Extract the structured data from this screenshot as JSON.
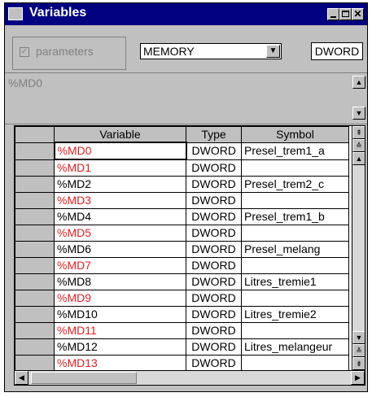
{
  "window": {
    "title": "Variables"
  },
  "toolbar": {
    "parameters_label": "parameters",
    "parameters_checked": true,
    "memory_select": "MEMORY",
    "type_button": "DWORD"
  },
  "comment": {
    "text": "%MD0"
  },
  "grid": {
    "headers": {
      "variable": "Variable",
      "type": "Type",
      "symbol": "Symbol"
    },
    "rows": [
      {
        "variable": "%MD0",
        "type": "DWORD",
        "symbol": "Presel_trem1_a",
        "red": true,
        "active": true
      },
      {
        "variable": "%MD1",
        "type": "DWORD",
        "symbol": "",
        "red": true
      },
      {
        "variable": "%MD2",
        "type": "DWORD",
        "symbol": "Presel_trem2_c",
        "red": false
      },
      {
        "variable": "%MD3",
        "type": "DWORD",
        "symbol": "",
        "red": true
      },
      {
        "variable": "%MD4",
        "type": "DWORD",
        "symbol": "Presel_trem1_b",
        "red": false
      },
      {
        "variable": "%MD5",
        "type": "DWORD",
        "symbol": "",
        "red": true
      },
      {
        "variable": "%MD6",
        "type": "DWORD",
        "symbol": "Presel_melang",
        "red": false
      },
      {
        "variable": "%MD7",
        "type": "DWORD",
        "symbol": "",
        "red": true
      },
      {
        "variable": "%MD8",
        "type": "DWORD",
        "symbol": "Litres_tremie1",
        "red": false
      },
      {
        "variable": "%MD9",
        "type": "DWORD",
        "symbol": "",
        "red": true
      },
      {
        "variable": "%MD10",
        "type": "DWORD",
        "symbol": "Litres_tremie2",
        "red": false
      },
      {
        "variable": "%MD11",
        "type": "DWORD",
        "symbol": "",
        "red": true
      },
      {
        "variable": "%MD12",
        "type": "DWORD",
        "symbol": "Litres_melangeur",
        "red": false
      },
      {
        "variable": "%MD13",
        "type": "DWORD",
        "symbol": "",
        "red": true
      }
    ]
  },
  "icons": {
    "minimize": "minimize-icon",
    "maximize": "maximize-icon",
    "close": "close-icon",
    "dropdown": "chevron-down-icon",
    "checkbox": "checkbox-icon"
  },
  "colors": {
    "titlebar": "#000080",
    "chrome": "#c0c0c0",
    "red_variable": "#e02020"
  }
}
